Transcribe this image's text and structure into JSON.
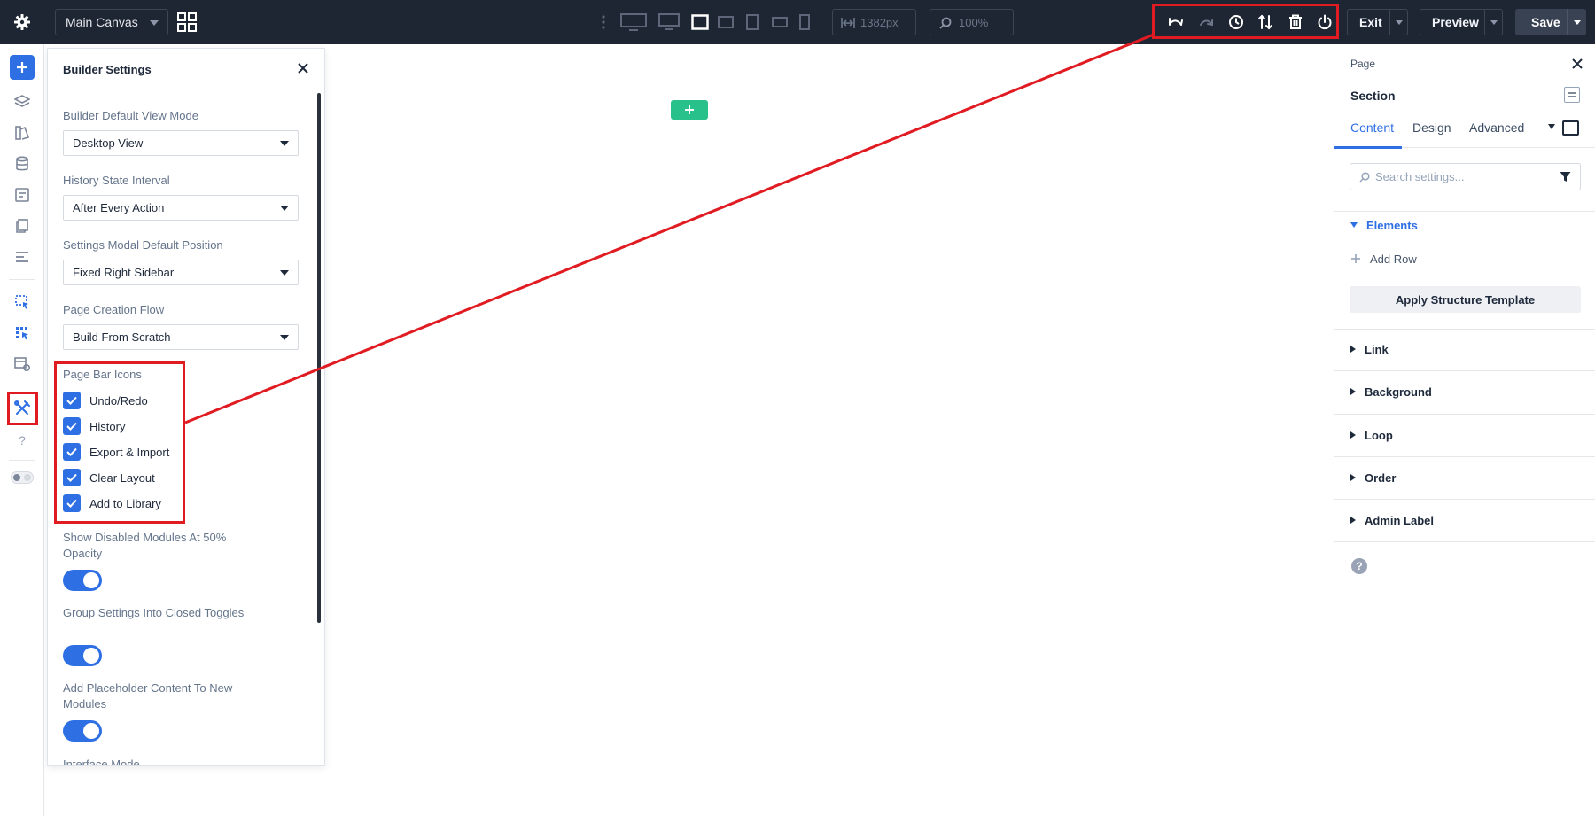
{
  "topbar": {
    "canvas_select": "Main Canvas",
    "width_value": "1382px",
    "zoom_value": "100%",
    "exit_label": "Exit",
    "preview_label": "Preview",
    "save_label": "Save"
  },
  "builder_settings": {
    "title": "Builder Settings",
    "fields": [
      {
        "label": "Builder Default View Mode",
        "value": "Desktop View"
      },
      {
        "label": "History State Interval",
        "value": "After Every Action"
      },
      {
        "label": "Settings Modal Default Position",
        "value": "Fixed Right Sidebar"
      },
      {
        "label": "Page Creation Flow",
        "value": "Build From Scratch"
      }
    ],
    "page_bar_icons": {
      "label": "Page Bar Icons",
      "items": [
        "Undo/Redo",
        "History",
        "Export & Import",
        "Clear Layout",
        "Add to Library"
      ]
    },
    "toggles": [
      {
        "label": "Show Disabled Modules At 50% Opacity",
        "on": true
      },
      {
        "label": "Group Settings Into Closed Toggles",
        "on": true
      },
      {
        "label": "Add Placeholder Content To New Modules",
        "on": true
      }
    ],
    "cut_label": "Interface Mode"
  },
  "right_panel": {
    "breadcrumb": "Page",
    "title": "Section",
    "tabs": [
      "Content",
      "Design",
      "Advanced"
    ],
    "active_tab": "Content",
    "search_placeholder": "Search settings...",
    "elements_group": "Elements",
    "add_row": "Add Row",
    "apply_template": "Apply Structure Template",
    "groups": [
      "Link",
      "Background",
      "Loop",
      "Order",
      "Admin Label"
    ],
    "help": "?"
  },
  "left_rail": {
    "help": "?"
  },
  "colors": {
    "accent": "#2f6fe4",
    "topbar": "#1e2633",
    "highlight": "#e01b22",
    "canvas_add": "#29c18b"
  }
}
